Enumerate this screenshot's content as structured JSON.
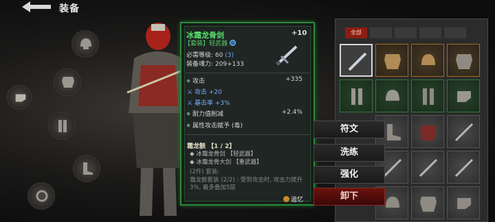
{
  "header": {
    "title": "装备",
    "back_icon": "back-arrow-icon"
  },
  "slots": [
    {
      "label": ""
    },
    {
      "label": ""
    },
    {
      "label": ""
    },
    {
      "label": ""
    },
    {
      "label": ""
    },
    {
      "label": ""
    }
  ],
  "tooltip": {
    "name": "冰霜龙骨剑",
    "enhance_level": "+10",
    "type": "【套装】轻武器",
    "required_level_label": "必需等级:",
    "required_level_value": "60",
    "required_level_extra": "(3)",
    "soul_label": "装备魂力:",
    "soul_value": "209+133",
    "attributes": [
      {
        "name": "攻击",
        "value": "+335",
        "style": "normal"
      },
      {
        "name": "攻击 +20",
        "value": "",
        "style": "blue"
      },
      {
        "name": "暴击率 +3%",
        "value": "",
        "style": "blue"
      },
      {
        "name": "耐力值削减",
        "value": "+2.4%",
        "style": "normal"
      },
      {
        "name": "属性攻击赋予 (毒)",
        "value": "",
        "style": "normal"
      }
    ],
    "set": {
      "title": "霜龙骸 【1 / 2】",
      "items": [
        "冰霜龙骨剑 【轻武器】",
        "冰霜龙骨大剑 【重武器】"
      ],
      "bonus_header": "(2件) 套装:",
      "bonus_desc": "霜龙骸套装 (2/2) : 受到攻击时, 攻击力提升3%, 最多叠加5层"
    },
    "recall_label": "追忆"
  },
  "actions": {
    "rune": "符文",
    "wash": "洗练",
    "enhance": "强化",
    "unequip": "卸下"
  },
  "inventory": {
    "active_tab": "全部",
    "colors": {
      "gold": "#a36d1e",
      "green": "#2f7a36",
      "selected": "#d7d7d7"
    }
  },
  "colors": {
    "rarity_green": "#53e06a",
    "accent_red": "#8b1d12"
  }
}
